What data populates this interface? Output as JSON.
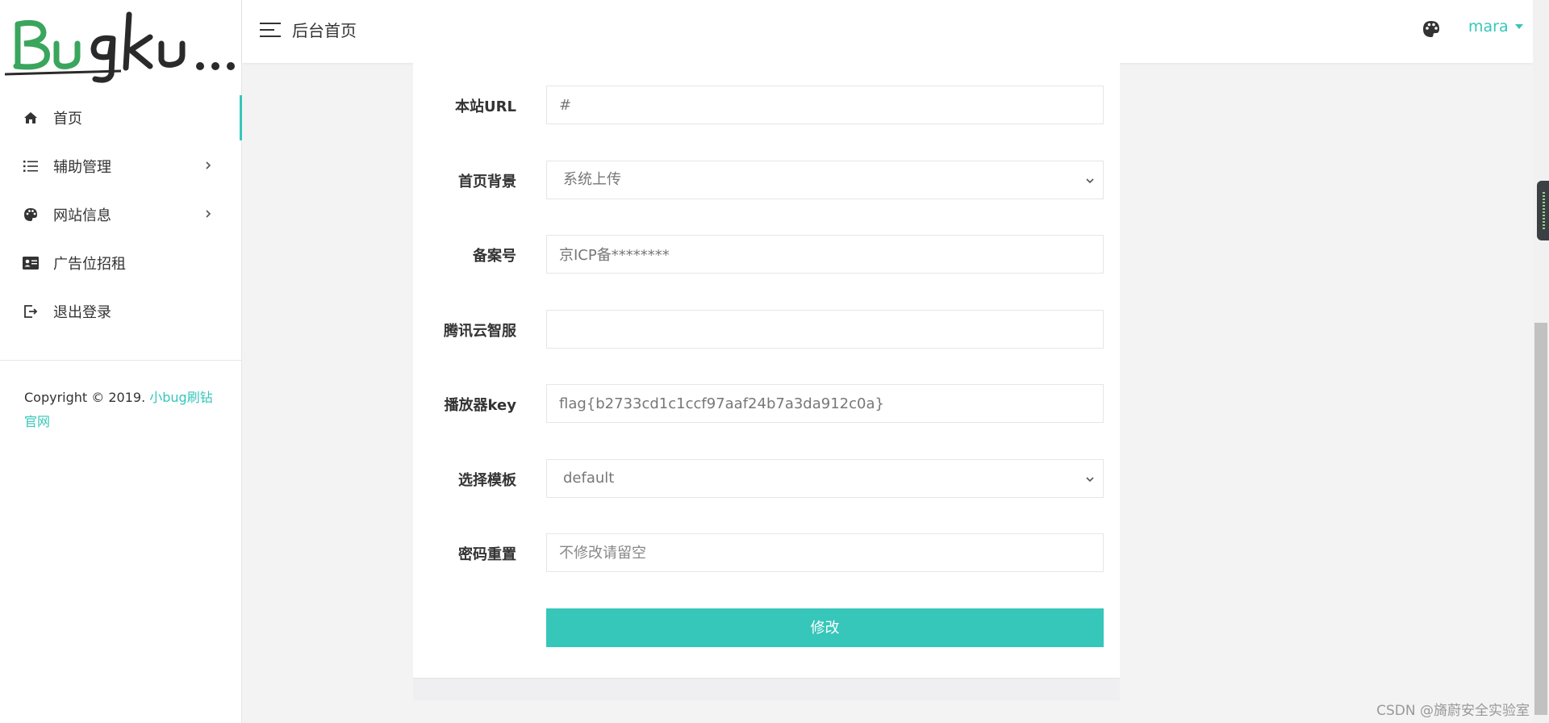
{
  "sidebar": {
    "logo_text": "Bugku...",
    "items": [
      {
        "label": "首页",
        "icon": "home-icon",
        "active": true
      },
      {
        "label": "辅助管理",
        "icon": "list-icon",
        "has_submenu": true
      },
      {
        "label": "网站信息",
        "icon": "palette-icon",
        "has_submenu": true
      },
      {
        "label": "广告位招租",
        "icon": "id-card-icon"
      },
      {
        "label": "退出登录",
        "icon": "logout-icon"
      }
    ],
    "copyright_prefix": "Copyright © 2019. ",
    "copyright_link": "小bug刷钻官网"
  },
  "header": {
    "title": "后台首页",
    "username": "mara"
  },
  "form": {
    "site_url": {
      "label": "本站URL",
      "value": "#"
    },
    "homepage_bg": {
      "label": "首页背景",
      "selected": "系统上传"
    },
    "icp": {
      "label": "备案号",
      "value": "京ICP备********"
    },
    "tencent_service": {
      "label": "腾讯云智服",
      "value": ""
    },
    "player_key": {
      "label": "播放器key",
      "value": "flag{b2733cd1c1ccf97aaf24b7a3da912c0a}"
    },
    "template": {
      "label": "选择模板",
      "selected": "default"
    },
    "password_reset": {
      "label": "密码重置",
      "placeholder": "不修改请留空"
    },
    "submit_label": "修改"
  },
  "watermark": "CSDN @旖蔚安全实验室",
  "colors": {
    "accent": "#36c6ba",
    "logo_green": "#3aa55d",
    "text": "#333333"
  }
}
